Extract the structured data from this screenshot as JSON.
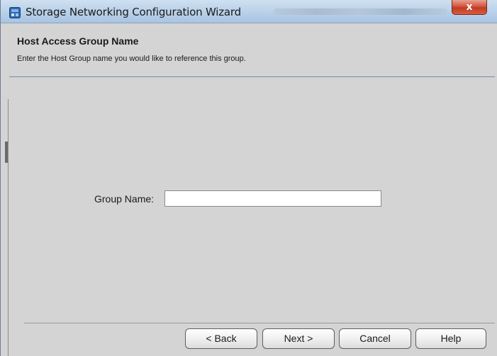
{
  "window": {
    "title": "Storage Networking Configuration Wizard",
    "title_extra_blurred": "",
    "close_label": "x",
    "title_icon": "app-window-icon"
  },
  "header": {
    "title": "Host Access Group Name",
    "subtitle": "Enter the Host Group name you would like to reference this group."
  },
  "form": {
    "group_name_label": "Group Name:",
    "group_name_value": ""
  },
  "buttons": {
    "back": "< Back",
    "next": "Next >",
    "cancel": "Cancel",
    "help": "Help"
  },
  "colors": {
    "titlebar": "#bcd3ea",
    "body": "#d4d4d4",
    "close": "#c7432b",
    "header_divider": "#7a87a8"
  }
}
